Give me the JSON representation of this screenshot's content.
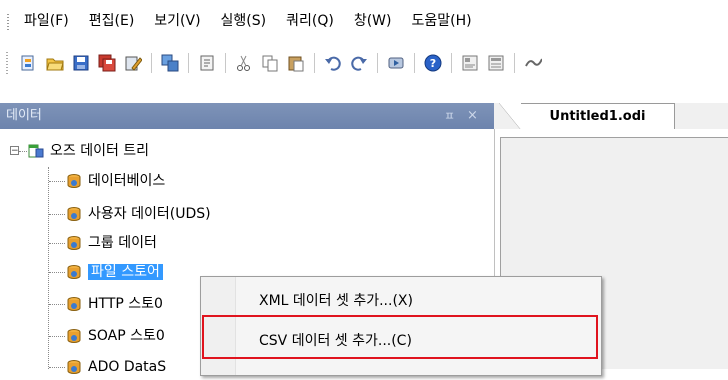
{
  "menubar": {
    "items": [
      "파일(F)",
      "편집(E)",
      "보기(V)",
      "실행(S)",
      "쿼리(Q)",
      "창(W)",
      "도움말(H)"
    ]
  },
  "toolbar": {
    "buttons": [
      "new-icon",
      "open-icon",
      "save-icon",
      "save-all-icon",
      "edit-icon",
      "window-icon",
      "properties-icon",
      "cut-icon",
      "copy-icon",
      "paste-icon",
      "undo-icon",
      "redo-icon",
      "run-icon",
      "help-icon",
      "report-icon",
      "report2-icon",
      "link-icon"
    ]
  },
  "panel": {
    "title": "데이터",
    "pin": "ㅍ",
    "close": "×"
  },
  "tab": {
    "label": "Untitled1.odi"
  },
  "tree": {
    "expander": "−",
    "root": "오즈 데이터 트리",
    "items": [
      "데이터베이스",
      "사용자 데이터(UDS)",
      "그룹 데이터",
      "파일 스토어",
      "HTTP 스토0",
      "SOAP 스토0",
      "ADO DataS"
    ]
  },
  "context_menu": {
    "items": [
      "XML 데이터 셋 추가...(X)",
      "CSV 데이터 셋 추가...(C)"
    ]
  },
  "colors": {
    "panel_header": "#7088b0",
    "selection": "#3399ff",
    "highlight_box": "#e0141e"
  }
}
